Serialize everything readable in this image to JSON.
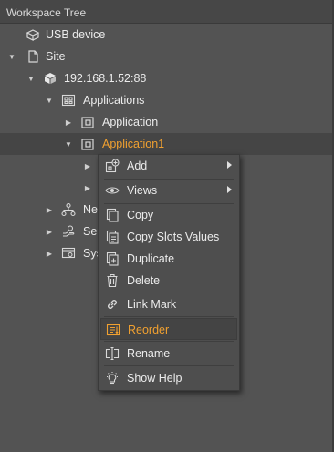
{
  "panel": {
    "title": "Workspace Tree"
  },
  "tree": [
    {
      "label": "USB device",
      "icon": "usb-device-icon",
      "expanded": null
    },
    {
      "label": "Site",
      "icon": "page-icon",
      "expanded": true
    },
    {
      "label": "192.168.1.52:88",
      "icon": "server-icon",
      "expanded": true
    },
    {
      "label": "Applications",
      "icon": "applications-folder-icon",
      "expanded": true
    },
    {
      "label": "Application",
      "icon": "application-icon",
      "expanded": false
    },
    {
      "label": "Application1",
      "icon": "application-icon",
      "expanded": true,
      "selected": true
    },
    {
      "label": "",
      "expanded": false
    },
    {
      "label": "",
      "expanded": false
    },
    {
      "label": "Net",
      "icon": "network-icon",
      "expanded": false
    },
    {
      "label": "Ser",
      "icon": "services-icon",
      "expanded": false
    },
    {
      "label": "Sys",
      "icon": "system-icon",
      "expanded": false
    }
  ],
  "context_menu": {
    "items": [
      {
        "label": "Add",
        "icon": "add-icon",
        "submenu": true
      },
      {
        "label": "Views",
        "icon": "eye-icon",
        "submenu": true
      },
      {
        "label": "Copy",
        "icon": "copy-icon"
      },
      {
        "label": "Copy Slots Values",
        "icon": "copy-slots-icon"
      },
      {
        "label": "Duplicate",
        "icon": "duplicate-icon"
      },
      {
        "label": "Delete",
        "icon": "trash-icon"
      },
      {
        "label": "Link Mark",
        "icon": "link-icon"
      },
      {
        "label": "Reorder",
        "icon": "reorder-icon",
        "highlighted": true
      },
      {
        "label": "Rename",
        "icon": "rename-icon"
      },
      {
        "label": "Show Help",
        "icon": "lightbulb-icon"
      }
    ]
  },
  "colors": {
    "accent": "#f0a030",
    "background": "#535353",
    "menu": "#4e4e4e"
  }
}
